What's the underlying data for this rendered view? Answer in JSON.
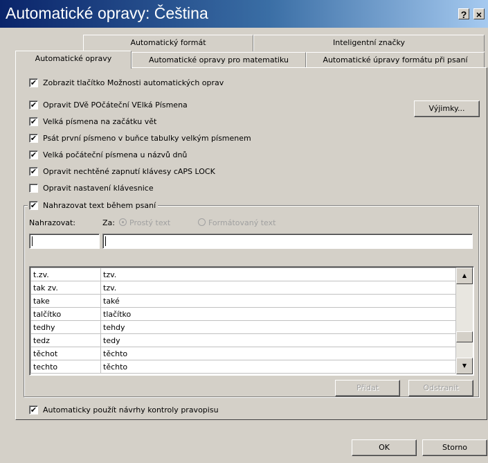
{
  "window": {
    "title": "Automatické opravy: Čeština",
    "help_label": "?",
    "close_label": "×"
  },
  "tabs": {
    "row1": [
      "Automatický formát",
      "Inteligentní značky"
    ],
    "row2": [
      "Automatické opravy",
      "Automatické opravy pro matematiku",
      "Automatické úpravy formátu při psaní"
    ],
    "active": "Automatické opravy"
  },
  "options": [
    {
      "label": "Zobrazit tlačítko Možnosti automatických oprav",
      "checked": true
    },
    {
      "label": "Opravit DVě POčáteční VElká Písmena",
      "checked": true
    },
    {
      "label": "Velká písmena na začátku vět",
      "checked": true
    },
    {
      "label": "Psát první písmeno v buňce tabulky velkým písmenem",
      "checked": true
    },
    {
      "label": "Velká počáteční písmena u názvů dnů",
      "checked": true
    },
    {
      "label": "Opravit nechtěné zapnutí klávesy cAPS LOCK",
      "checked": true
    },
    {
      "label": "Opravit nastavení klávesnice",
      "checked": false
    }
  ],
  "exceptions_button": "Výjimky...",
  "replace": {
    "checkbox_label": "Nahrazovat text během psaní",
    "checked": true,
    "replace_label": "Nahrazovat:",
    "with_label": "Za:",
    "radio_plain": "Prostý text",
    "radio_formatted": "Formátovaný text",
    "replace_value": "",
    "with_value": ""
  },
  "entries": [
    [
      "t.zv.",
      "tzv."
    ],
    [
      "tak zv.",
      "tzv."
    ],
    [
      "take",
      "také"
    ],
    [
      "talčítko",
      "tlačítko"
    ],
    [
      "tedhy",
      "tehdy"
    ],
    [
      "tedz",
      "tedy"
    ],
    [
      "těchot",
      "těchto"
    ],
    [
      "techto",
      "těchto"
    ]
  ],
  "add_button": "Přidat",
  "delete_button": "Odstranit",
  "spellcheck": {
    "label": "Automaticky použít návrhy kontroly pravopisu",
    "checked": true
  },
  "ok_button": "OK",
  "cancel_button": "Storno",
  "colors": {
    "title_start": "#0a246a",
    "title_end": "#a6caf0",
    "face": "#d4d0c8"
  },
  "icons": {
    "check": "✔",
    "scroll_up": "▲",
    "scroll_down": "▼"
  }
}
